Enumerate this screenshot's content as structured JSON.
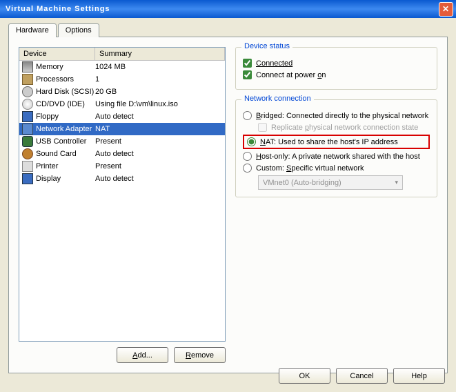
{
  "window": {
    "title": "Virtual Machine Settings"
  },
  "tabs": {
    "hardware": "Hardware",
    "options": "Options"
  },
  "table": {
    "head_device": "Device",
    "head_summary": "Summary",
    "rows": [
      {
        "icon": "ic-chip",
        "device": "Memory",
        "summary": "1024 MB"
      },
      {
        "icon": "ic-cpu",
        "device": "Processors",
        "summary": "1"
      },
      {
        "icon": "ic-hd",
        "device": "Hard Disk (SCSI)",
        "summary": "20 GB"
      },
      {
        "icon": "ic-cd",
        "device": "CD/DVD (IDE)",
        "summary": "Using file D:\\vm\\linux.iso"
      },
      {
        "icon": "ic-fd",
        "device": "Floppy",
        "summary": "Auto detect"
      },
      {
        "icon": "ic-net",
        "device": "Network Adapter",
        "summary": "NAT",
        "selected": true
      },
      {
        "icon": "ic-usb",
        "device": "USB Controller",
        "summary": "Present"
      },
      {
        "icon": "ic-snd",
        "device": "Sound Card",
        "summary": "Auto detect"
      },
      {
        "icon": "ic-prn",
        "device": "Printer",
        "summary": "Present"
      },
      {
        "icon": "ic-disp",
        "device": "Display",
        "summary": "Auto detect"
      }
    ]
  },
  "buttons": {
    "add": "Add...",
    "remove": "Remove",
    "ok": "OK",
    "cancel": "Cancel",
    "help": "Help"
  },
  "status": {
    "title": "Device status",
    "connected": "Connected",
    "poweron": "Connect at power on"
  },
  "netconn": {
    "title": "Network connection",
    "bridged": "Bridged: Connected directly to the physical network",
    "replicate": "Replicate physical network connection state",
    "nat": "NAT: Used to share the host's IP address",
    "hostonly": "Host-only: A private network shared with the host",
    "custom": "Custom: Specific virtual network",
    "vmnet": "VMnet0 (Auto-bridging)",
    "underline": {
      "b": "B",
      "n": "N",
      "h": "H",
      "s": "S",
      "o": "o",
      "p": "p",
      "d": "d",
      "r": "R"
    }
  }
}
